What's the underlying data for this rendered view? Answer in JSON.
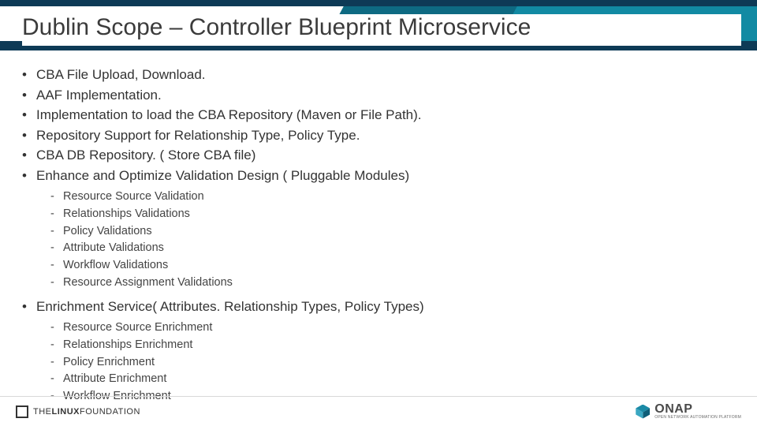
{
  "title": "Dublin Scope – Controller Blueprint Microservice",
  "bullets": [
    {
      "text": "CBA File Upload, Download."
    },
    {
      "text": "AAF Implementation."
    },
    {
      "text": "Implementation to load the CBA Repository (Maven or File Path)."
    },
    {
      "text": "Repository Support for Relationship Type, Policy Type."
    },
    {
      "text": "CBA DB Repository. ( Store CBA file)"
    },
    {
      "text": "Enhance and Optimize Validation Design ( Pluggable Modules)",
      "sub": [
        "Resource Source Validation",
        "Relationships Validations",
        "Policy Validations",
        "Attribute Validations",
        "Workflow Validations",
        "Resource Assignment Validations"
      ]
    },
    {
      "text": "Enrichment Service( Attributes. Relationship Types, Policy Types)",
      "sub": [
        "Resource Source Enrichment",
        "Relationships Enrichment",
        "Policy Enrichment",
        "Attribute Enrichment",
        "Workflow Enrichment"
      ]
    }
  ],
  "footer": {
    "linux_the": "THE",
    "linux_name": "LINUX",
    "linux_suffix": "FOUNDATION",
    "onap_name": "ONAP",
    "onap_tag": "OPEN NETWORK AUTOMATION PLATFORM"
  }
}
